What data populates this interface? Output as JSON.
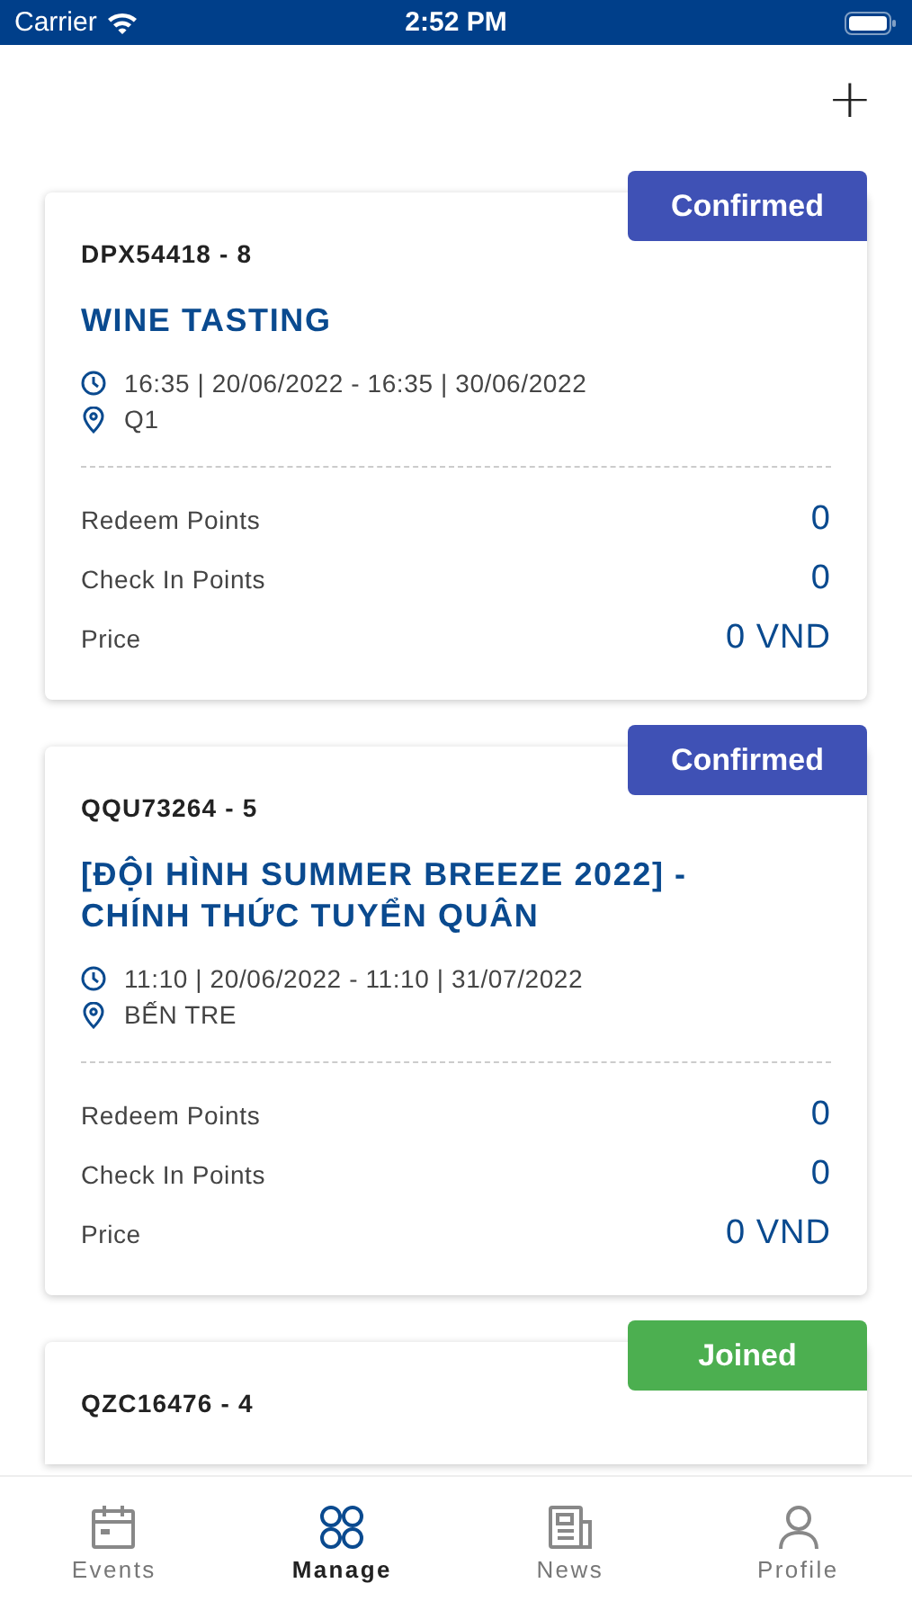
{
  "status_bar": {
    "carrier": "Carrier",
    "time": "2:52 PM"
  },
  "header": {
    "add_button": "+"
  },
  "bookings": [
    {
      "code": "DPX54418 - 8",
      "status": {
        "label": "Confirmed",
        "kind": "confirmed"
      },
      "title": "WINE TASTING",
      "time": "16:35 | 20/06/2022 - 16:35 | 30/06/2022",
      "location": "Q1",
      "rows": [
        {
          "label": "Redeem Points",
          "value": "0"
        },
        {
          "label": "Check In Points",
          "value": "0"
        },
        {
          "label": "Price",
          "value": "0 VND"
        }
      ]
    },
    {
      "code": "QQU73264 - 5",
      "status": {
        "label": "Confirmed",
        "kind": "confirmed"
      },
      "title": "[ĐỘI HÌNH SUMMER BREEZE 2022] - CHÍNH THỨC TUYỂN QUÂN",
      "time": "11:10 | 20/06/2022 - 11:10 | 31/07/2022",
      "location": "BẾN TRE",
      "rows": [
        {
          "label": "Redeem Points",
          "value": "0"
        },
        {
          "label": "Check In Points",
          "value": "0"
        },
        {
          "label": "Price",
          "value": "0 VND"
        }
      ]
    },
    {
      "code": "QZC16476 - 4",
      "status": {
        "label": "Joined",
        "kind": "joined"
      }
    }
  ],
  "tab_bar": [
    {
      "label": "Events",
      "selected": false
    },
    {
      "label": "Manage",
      "selected": true
    },
    {
      "label": "News",
      "selected": false
    },
    {
      "label": "Profile",
      "selected": false
    }
  ]
}
